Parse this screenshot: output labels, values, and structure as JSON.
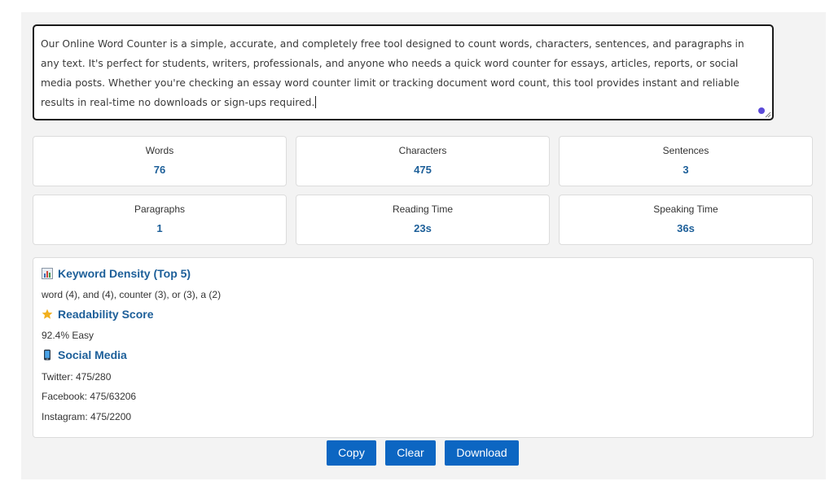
{
  "editor": {
    "text": "Our Online Word Counter is a simple, accurate, and completely free tool designed to count words, characters, sentences, and paragraphs in any text. It's perfect for students, writers, professionals, and anyone who needs a quick word counter for essays, articles, reports, or social media posts. Whether you're checking an essay word counter limit or tracking document word count, this tool provides instant and reliable results in real-time no downloads or sign-ups required."
  },
  "stats": [
    {
      "label": "Words",
      "value": "76"
    },
    {
      "label": "Characters",
      "value": "475"
    },
    {
      "label": "Sentences",
      "value": "3"
    },
    {
      "label": "Paragraphs",
      "value": "1"
    },
    {
      "label": "Reading Time",
      "value": "23s"
    },
    {
      "label": "Speaking Time",
      "value": "36s"
    }
  ],
  "insights": {
    "keyword_heading": "Keyword Density (Top 5)",
    "keyword_text": "word (4), and (4), counter (3), or (3), a (2)",
    "readability_heading": "Readability Score",
    "readability_text": "92.4% Easy",
    "social_heading": "Social Media",
    "social_lines": [
      "Twitter: 475/280",
      "Facebook: 475/63206",
      "Instagram: 475/2200"
    ]
  },
  "buttons": {
    "copy": "Copy",
    "clear": "Clear",
    "download": "Download"
  },
  "icons": {
    "keyword": "bar-chart-icon",
    "readability": "star-icon",
    "social": "mobile-phone-icon"
  },
  "colors": {
    "accent": "#1d5f99",
    "button": "#0c66c2",
    "star": "#f2b01e"
  }
}
